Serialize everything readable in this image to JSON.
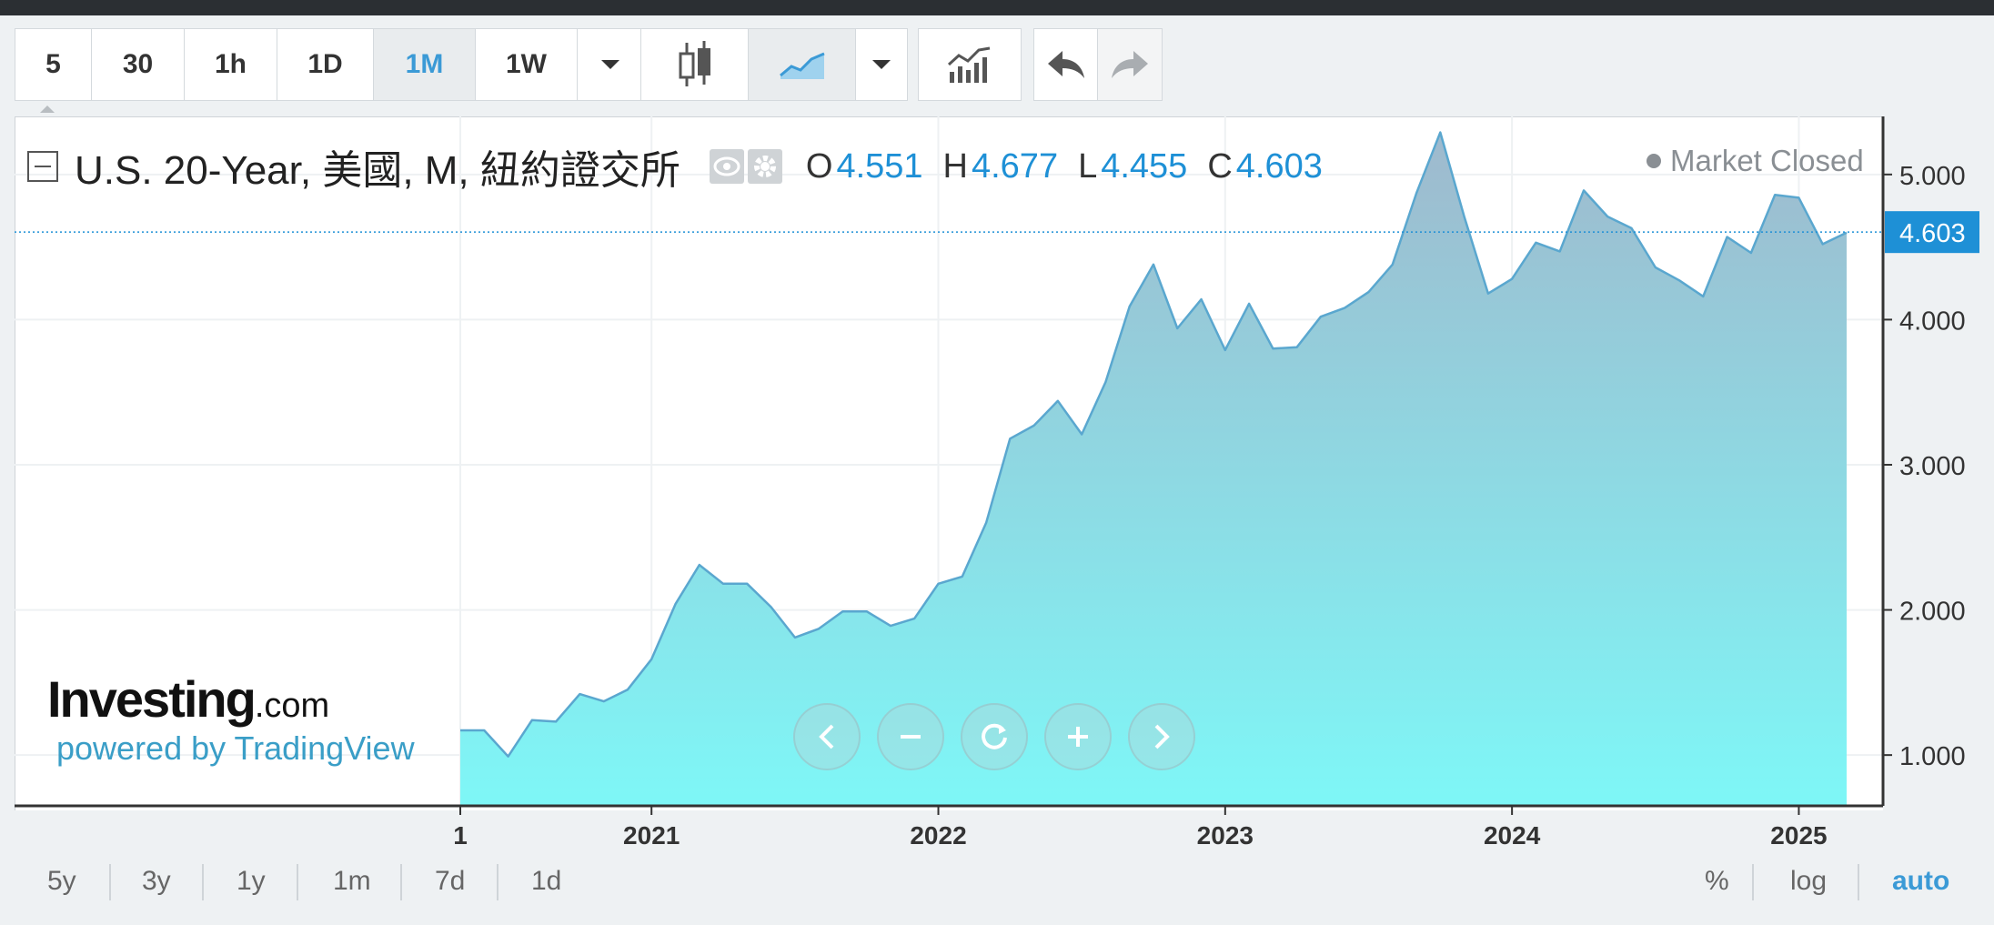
{
  "toolbar": {
    "intervals": [
      "5",
      "30",
      "1h",
      "1D",
      "1M",
      "1W"
    ],
    "active_interval": "1M",
    "icons": [
      "candlestick-icon",
      "area-chart-icon",
      "chevron-down-icon",
      "indicators-icon",
      "undo-icon",
      "redo-icon"
    ]
  },
  "legend": {
    "title": "U.S. 20-Year, 美國, M, 紐約證交所",
    "open_label": "O",
    "open": "4.551",
    "high_label": "H",
    "high": "4.677",
    "low_label": "L",
    "low": "4.455",
    "close_label": "C",
    "close": "4.603",
    "status": "Market Closed"
  },
  "branding": {
    "logo_main": "Investing",
    "logo_suffix": ".com",
    "powered_by": "powered by TradingView"
  },
  "price_axis": {
    "last_price": "4.603"
  },
  "bottom_bar": {
    "ranges": [
      "5y",
      "3y",
      "1y",
      "1m",
      "7d",
      "1d"
    ],
    "options": [
      "%",
      "log",
      "auto"
    ],
    "active_option": "auto"
  },
  "colors": {
    "accent": "#1e90d6",
    "line": "#5aa7cf",
    "area_top": "#9fb9cd",
    "area_bottom": "#7ef7f7"
  },
  "chart_data": {
    "type": "area",
    "title": "U.S. 20-Year, 美國, M, 紐約證交所",
    "xlabel": "",
    "ylabel": "",
    "x_tick_labels": [
      "1",
      "2021",
      "2022",
      "2023",
      "2024",
      "2025"
    ],
    "y_tick_labels": [
      "1.000",
      "2.000",
      "3.000",
      "4.000",
      "5.000"
    ],
    "ylim": [
      0.65,
      5.4
    ],
    "grid": true,
    "legend": "none",
    "last_value": 4.603,
    "x": [
      "2020-05",
      "2020-06",
      "2020-07",
      "2020-08",
      "2020-09",
      "2020-10",
      "2020-11",
      "2020-12",
      "2021-01",
      "2021-02",
      "2021-03",
      "2021-04",
      "2021-05",
      "2021-06",
      "2021-07",
      "2021-08",
      "2021-09",
      "2021-10",
      "2021-11",
      "2021-12",
      "2022-01",
      "2022-02",
      "2022-03",
      "2022-04",
      "2022-05",
      "2022-06",
      "2022-07",
      "2022-08",
      "2022-09",
      "2022-10",
      "2022-11",
      "2022-12",
      "2023-01",
      "2023-02",
      "2023-03",
      "2023-04",
      "2023-05",
      "2023-06",
      "2023-07",
      "2023-08",
      "2023-09",
      "2023-10",
      "2023-11",
      "2023-12",
      "2024-01",
      "2024-02",
      "2024-03",
      "2024-04",
      "2024-05",
      "2024-06",
      "2024-07",
      "2024-08",
      "2024-09",
      "2024-10",
      "2024-11",
      "2024-12",
      "2025-01",
      "2025-02",
      "2025-03"
    ],
    "values": [
      1.17,
      1.17,
      0.99,
      1.24,
      1.23,
      1.42,
      1.37,
      1.45,
      1.66,
      2.04,
      2.31,
      2.18,
      2.18,
      2.02,
      1.81,
      1.87,
      1.99,
      1.99,
      1.89,
      1.94,
      2.18,
      2.23,
      2.6,
      3.18,
      3.27,
      3.44,
      3.21,
      3.57,
      4.09,
      4.38,
      3.94,
      4.14,
      3.79,
      4.11,
      3.8,
      3.81,
      4.02,
      4.08,
      4.19,
      4.38,
      4.87,
      5.29,
      4.71,
      4.18,
      4.28,
      4.53,
      4.47,
      4.89,
      4.71,
      4.63,
      4.36,
      4.27,
      4.16,
      4.57,
      4.46,
      4.86,
      4.84,
      4.52,
      4.6
    ]
  }
}
